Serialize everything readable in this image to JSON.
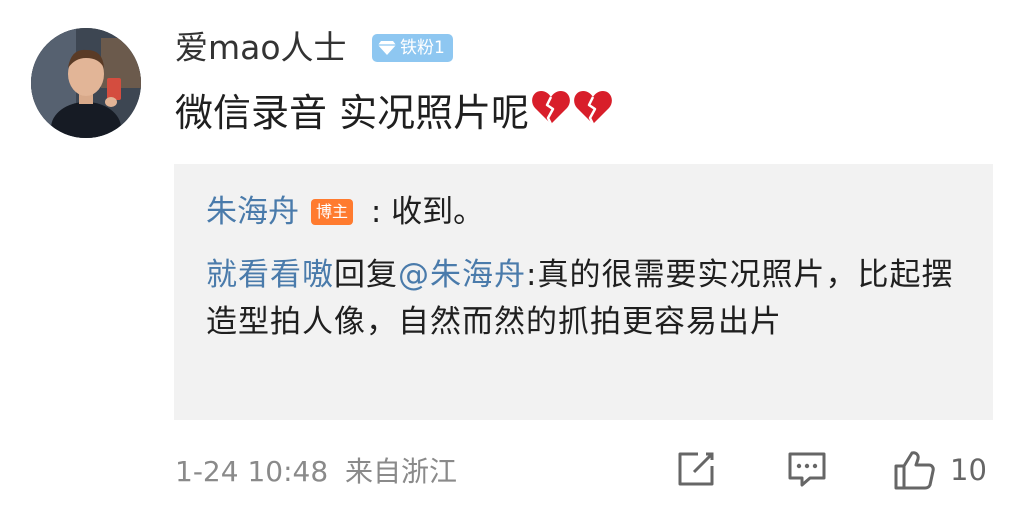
{
  "comment": {
    "username": "爱mao人士",
    "fan_badge": "铁粉1",
    "text": "微信录音 实况照片呢",
    "emoji": [
      "broken-heart",
      "broken-heart"
    ]
  },
  "replies": [
    {
      "author": "朱海舟",
      "badge": "博主",
      "separator": " : ",
      "text": "收到。"
    },
    {
      "author": "就看看嗷",
      "reply_word": "回复",
      "mention": "@朱海舟",
      "text": ":真的很需要实况照片，比起摆造型拍人像，自然而然的抓拍更容易出片"
    }
  ],
  "footer": {
    "time": "1-24 10:48",
    "location": "来自浙江",
    "like_count": "10"
  },
  "colors": {
    "link_blue": "#4a7bab",
    "fan_badge_bg": "#8ec7f1",
    "owner_badge_bg": "#ff7b2f",
    "heart_red": "#d81e2a",
    "reply_bg": "#f2f2f2"
  }
}
